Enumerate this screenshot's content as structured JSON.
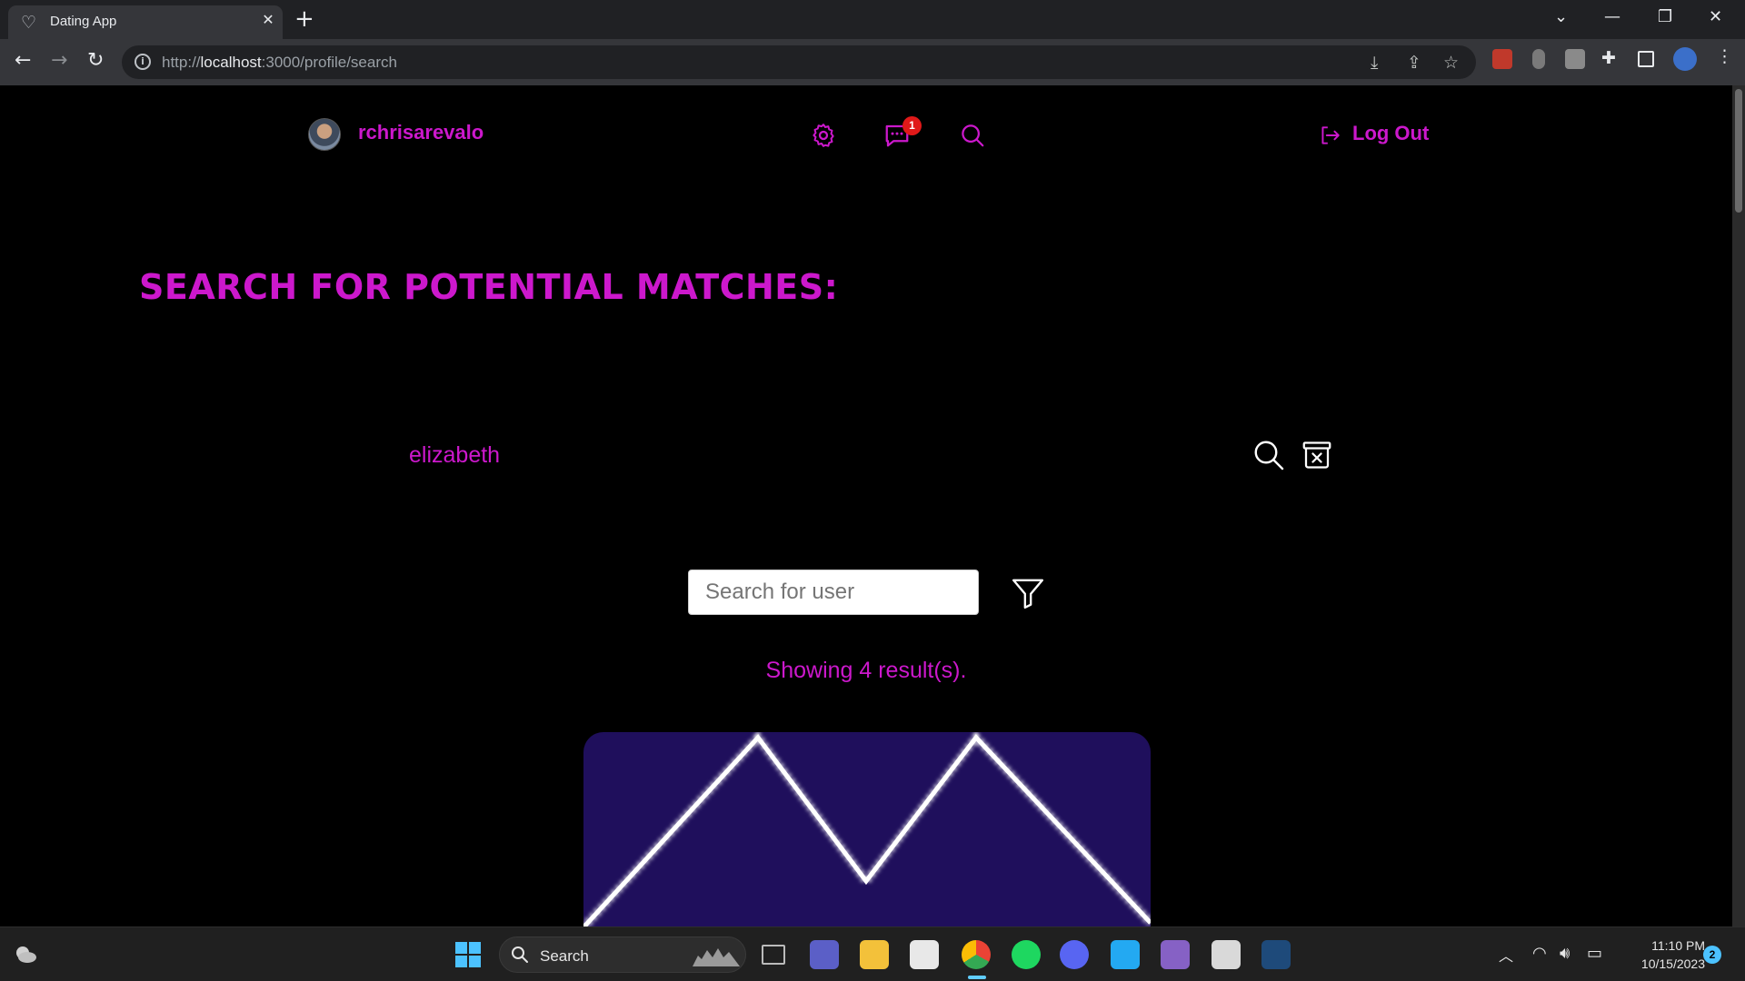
{
  "browser": {
    "tab_title": "Dating App",
    "url_scheme": "http://",
    "url_host": "localhost",
    "url_path": ":3000/profile/search",
    "tab_favicon": "heart-outline-icon"
  },
  "nav": {
    "username": "rchrisarevalo",
    "message_badge": "1",
    "logout_label": "Log Out",
    "accent_color": "#cc18cc"
  },
  "page": {
    "heading": "SEARCH FOR POTENTIAL MATCHES:",
    "saved_search_term": "elizabeth",
    "search_placeholder": "Search for user",
    "search_value": "",
    "result_count": "Showing 4 result(s).",
    "card_background": "#1f0f5c"
  },
  "taskbar": {
    "search_label": "Search",
    "time": "11:10 PM",
    "date": "10/15/2023",
    "notification_count": "2"
  }
}
